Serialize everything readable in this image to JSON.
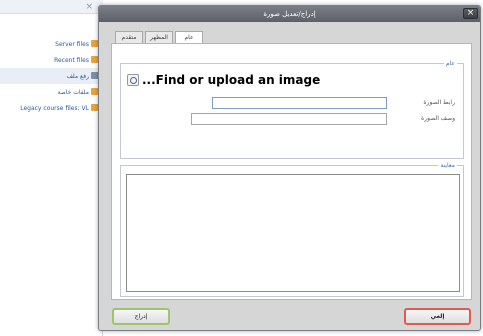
{
  "background_panel": {
    "items": [
      {
        "label": "Server files",
        "icon": "folder-icon"
      },
      {
        "label": "Recent files",
        "icon": "folder-icon"
      },
      {
        "label": "رفع ملف",
        "icon": "upload-icon"
      },
      {
        "label": "ملفات خاصة",
        "icon": "folder-icon"
      },
      {
        "label": "Legacy course files: VL",
        "icon": "folder-icon"
      }
    ]
  },
  "dialog": {
    "title": "إدراج/تعديل صورة",
    "close_label": "×",
    "tabs": [
      {
        "label": "متقدم"
      },
      {
        "label": "المظهر"
      },
      {
        "label": "عام"
      }
    ],
    "general_legend": "عام",
    "find_upload_label": "...Find or upload an image",
    "image_url_label": "رابط الصورة",
    "image_url_value": "",
    "image_desc_label": "وصف الصورة",
    "image_desc_value": "",
    "preview_legend": "معاينة",
    "insert_button": "إدراج",
    "cancel_button": "إلغي"
  },
  "colors": {
    "titlebar": "#5b6068",
    "insert_border": "#9cc56d",
    "cancel_border": "#e15a52",
    "legend_text": "#3a6cb3"
  }
}
